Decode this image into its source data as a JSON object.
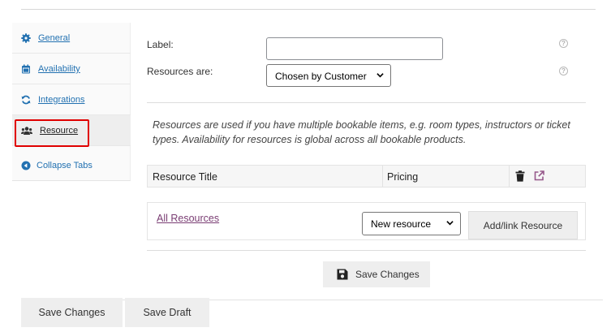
{
  "sidebar": {
    "tabs": [
      {
        "label": "General",
        "icon": "gear-icon"
      },
      {
        "label": "Availability",
        "icon": "calendar-icon"
      },
      {
        "label": "Integrations",
        "icon": "sync-icon"
      },
      {
        "label": "Resource",
        "icon": "users-icon",
        "active": true
      },
      {
        "label": "Collapse Tabs",
        "icon": "collapse-arrow-icon"
      }
    ],
    "highlight_color": "#e00000"
  },
  "form": {
    "label_field_label": "Label:",
    "label_field_value": "",
    "resources_are_label": "Resources are:",
    "resources_are_value": "Chosen by Customer"
  },
  "description": "Resources are used if you have multiple bookable items, e.g. room types, instructors or ticket types. Availability for resources is global across all bookable products.",
  "resource_table": {
    "columns": [
      "Resource Title",
      "Pricing"
    ]
  },
  "resource_actions": {
    "all_resources_link": "All Resources",
    "new_resource_value": "New resource",
    "add_link_button": "Add/link Resource"
  },
  "save_changes_inner": "Save Changes",
  "footer": {
    "save_changes": "Save Changes",
    "save_draft": "Save Draft"
  },
  "colors": {
    "link_blue": "#2271b1",
    "link_purple": "#7a3d73",
    "button_gray": "#eeeeee"
  }
}
